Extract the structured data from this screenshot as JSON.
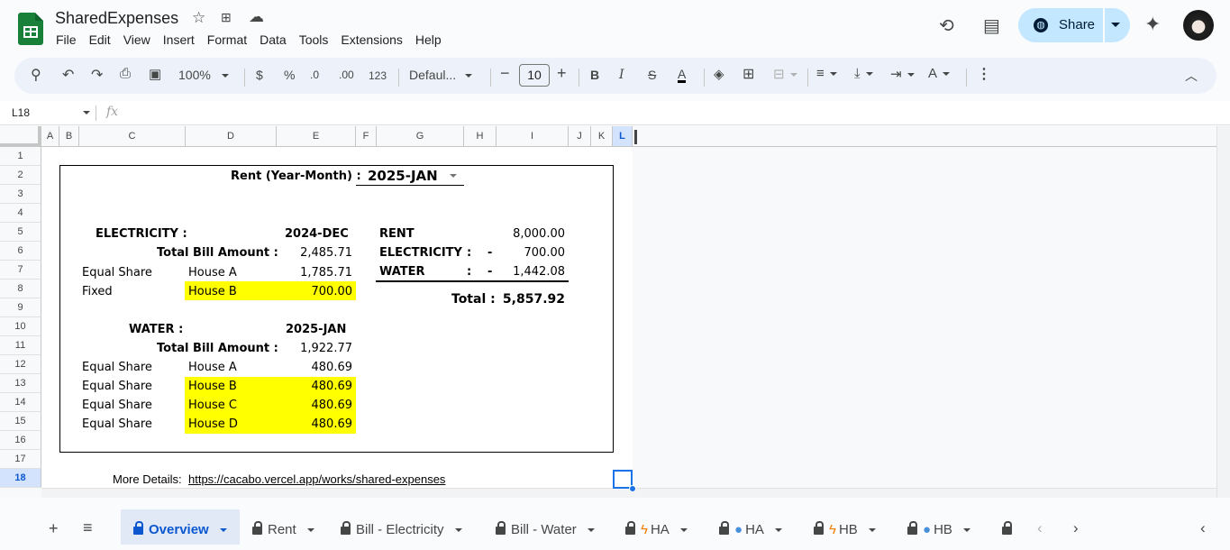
{
  "app": {
    "title": "SharedExpenses",
    "menu": [
      "File",
      "Edit",
      "View",
      "Insert",
      "Format",
      "Data",
      "Tools",
      "Extensions",
      "Help"
    ],
    "share_label": "Share"
  },
  "toolbar": {
    "zoom": "100%",
    "currency": "$",
    "percent": "%",
    "dec_decrease": ".0",
    "dec_increase": ".00",
    "number_format": "123",
    "font": "Defaul...",
    "font_size": "10",
    "bold": "B",
    "italic": "I",
    "text_color": "A"
  },
  "formula_bar": {
    "cell_ref": "L18",
    "fx": "fx",
    "value": ""
  },
  "columns": [
    "A",
    "B",
    "C",
    "D",
    "E",
    "F",
    "G",
    "H",
    "I",
    "J",
    "K",
    "L"
  ],
  "rows": [
    "1",
    "2",
    "3",
    "4",
    "5",
    "6",
    "7",
    "8",
    "9",
    "10",
    "11",
    "12",
    "13",
    "14",
    "15",
    "16",
    "17",
    "18"
  ],
  "sheet": {
    "rent_label": "Rent (Year-Month) :",
    "rent_month": "2025-JAN",
    "electricity": {
      "label": "ELECTRICITY :",
      "period": "2024-DEC",
      "total_label": "Total Bill Amount :",
      "total": "2,485.71",
      "rows": [
        {
          "type": "Equal Share",
          "house": "House A",
          "amount": "1,785.71",
          "highlight": false
        },
        {
          "type": "Fixed",
          "house": "House B",
          "amount": "700.00",
          "highlight": true
        }
      ]
    },
    "water": {
      "label": "WATER :",
      "period": "2025-JAN",
      "total_label": "Total Bill Amount :",
      "total": "1,922.77",
      "rows": [
        {
          "type": "Equal Share",
          "house": "House A",
          "amount": "480.69",
          "highlight": false
        },
        {
          "type": "Equal Share",
          "house": "House B",
          "amount": "480.69",
          "highlight": true
        },
        {
          "type": "Equal Share",
          "house": "House C",
          "amount": "480.69",
          "highlight": true
        },
        {
          "type": "Equal Share",
          "house": "House D",
          "amount": "480.69",
          "highlight": true
        }
      ]
    },
    "summary": {
      "rent_label": "RENT",
      "rent_value": "8,000.00",
      "electricity_label": "ELECTRICITY",
      "electricity_colon": ":",
      "electricity_sign": "-",
      "electricity_value": "700.00",
      "water_label": "WATER",
      "water_colon": ":",
      "water_sign": "-",
      "water_value": "1,442.08",
      "total_label": "Total :",
      "total_value": "5,857.92"
    },
    "more_details_label": "More Details:",
    "more_details_link": "https://cacabo.vercel.app/works/shared-expenses",
    "highlight_color": "#ffff00"
  },
  "tabs": [
    {
      "label": "Overview",
      "icon": "",
      "active": true
    },
    {
      "label": "Rent",
      "icon": "",
      "active": false
    },
    {
      "label": "Bill - Electricity",
      "icon": "",
      "active": false
    },
    {
      "label": "Bill - Water",
      "icon": "",
      "active": false
    },
    {
      "label": "HA",
      "icon": "bolt",
      "active": false
    },
    {
      "label": "HA",
      "icon": "drop",
      "active": false
    },
    {
      "label": "HB",
      "icon": "bolt",
      "active": false
    },
    {
      "label": "HB",
      "icon": "drop",
      "active": false
    }
  ],
  "colors": {
    "accent": "#0b57d0",
    "share_bg": "#c2e7ff",
    "logo": "#188038"
  }
}
